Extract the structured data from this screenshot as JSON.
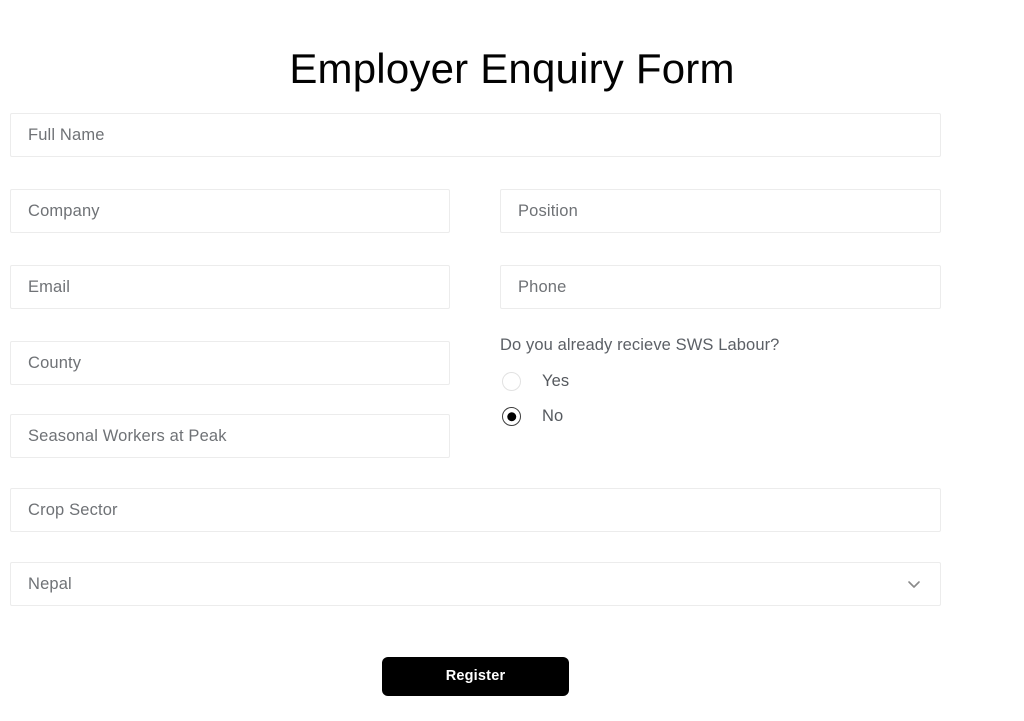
{
  "page": {
    "title": "Employer Enquiry Form",
    "background_color": "#ffffff",
    "text_color": "#020202",
    "placeholder_color": "#6f7276",
    "border_color": "#ececec",
    "accent_color": "#000000"
  },
  "fields": {
    "full_name": {
      "placeholder": "Full Name",
      "value": ""
    },
    "company": {
      "placeholder": "Company",
      "value": ""
    },
    "position": {
      "placeholder": "Position",
      "value": ""
    },
    "email": {
      "placeholder": "Email",
      "value": ""
    },
    "phone": {
      "placeholder": "Phone",
      "value": ""
    },
    "county": {
      "placeholder": "County",
      "value": ""
    },
    "seasonal_workers": {
      "placeholder": "Seasonal Workers at Peak",
      "value": ""
    },
    "crop_sector": {
      "placeholder": "Crop Sector",
      "value": ""
    }
  },
  "country_select": {
    "selected": "Nepal",
    "icon": "chevron-down-icon"
  },
  "radio_group": {
    "question": "Do you already recieve SWS Labour?",
    "options": [
      {
        "label": "Yes",
        "selected": false
      },
      {
        "label": "No",
        "selected": true
      }
    ]
  },
  "submit": {
    "label": "Register"
  }
}
